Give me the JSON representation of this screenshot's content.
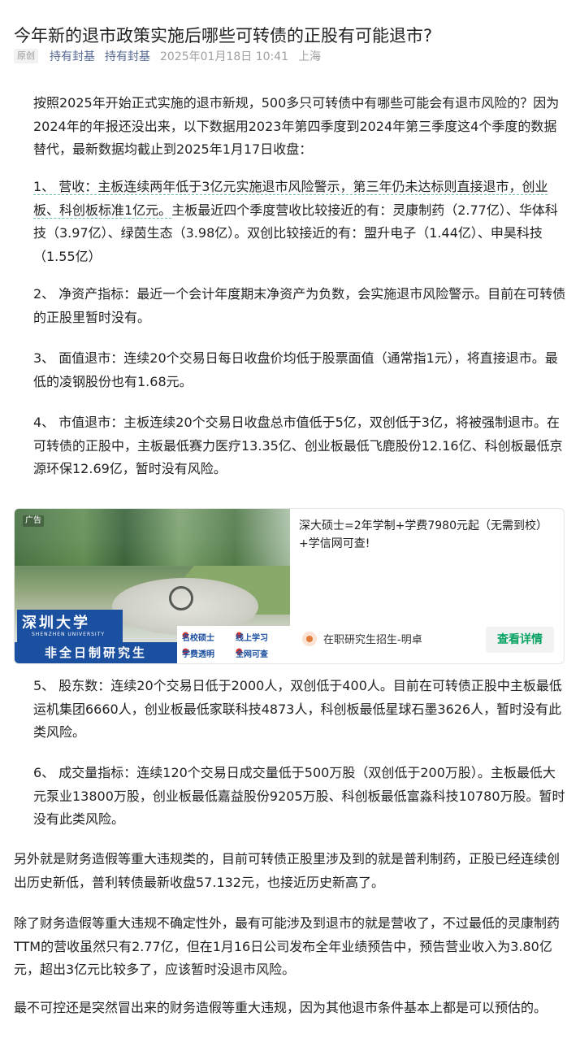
{
  "article": {
    "title": "今年新的退市政策实施后哪些可转债的正股有可能退市?",
    "badge": "原创",
    "author": "持有封基",
    "account": "持有封基",
    "datetime": "2025年01月18日 10:41",
    "location": "上海"
  },
  "paragraphs": {
    "intro": "按照2025年开始正式实施的退市新规，500多只可转债中有哪些可能会有退市风险的？因为2024年的年报还没出来，以下数据用2023年第四季度到2024年第三季度这4个季度的数据替代，最新数据均截止到2025年1月17日收盘：",
    "p1_lead": "1、 营收：主板连续两年低于3亿元实施退市风险警示，第三年仍未达标则直接退市，创业板、科创板标准1亿元。",
    "p1_rest": "主板最近四个季度营收比较接近的有：灵康制药（2.77亿）、华体科技（3.97亿）、绿茵生态（3.98亿）。双创比较接近的有：盟升电子（1.44亿）、申昊科技（1.55亿）",
    "p2": "2、 净资产指标：最近一个会计年度期末净资产为负数，会实施退市风险警示。目前在可转债的正股里暂时没有。",
    "p3": "3、 面值退市：连续20个交易日每日收盘价均低于股票面值（通常指1元），将直接退市。最低的凌钢股份也有1.68元。",
    "p4": "4、 市值退市：主板连续20个交易日收盘总市值低于5亿，双创低于3亿，将被强制退市。在可转债的正股中，主板最低赛力医疗13.35亿、创业板最低飞鹿股份12.16亿、科创板最低京源环保12.69亿，暂时没有风险。",
    "p5": "5、 股东数：连续20个交易日低于2000人，双创低于400人。目前在可转债正股中主板最低运机集团6660人，创业板最低家联科技4873人，科创板最低星球石墨3626人，暂时没有此类风险。",
    "p6": "6、 成交量指标：连续120个交易日成交量低于500万股（双创低于200万股）。主板最低大元泵业13800万股，创业板最低嘉益股份9205万股、科创板最低富淼科技10780万股。暂时没有此类风险。",
    "p7": "另外就是财务造假等重大违规类的，目前可转债正股里涉及到的就是普利制药，正股已经连续创出历史新低，普利转债最新收盘57.132元，也接近历史新高了。",
    "p8": "除了财务造假等重大违规不确定性外，最有可能涉及到退市的就是营收了，不过最低的灵康制药TTM的营收虽然只有2.77亿，但在1月16日公司发布全年业绩预告中，预告营业收入为3.80亿元，超出3亿元比较多了，应该暂时没退市风险。",
    "p9": "最不可控还是突然冒出来的财务造假等重大违规，因为其他退市条件基本上都是可以预估的。"
  },
  "ad": {
    "tag": "广告",
    "university_cn": "深圳大学",
    "university_en": "SHENZHEN UNIVERSITY",
    "banner": "非全日制研究生",
    "points": [
      "名校硕士",
      "线上学习",
      "学费透明",
      "全网可查"
    ],
    "headline": "深大硕士=2年学制+学费7980元起（无需到校）+学信网可查!",
    "source": "在职研究生招生-明卓",
    "cta": "查看详情"
  },
  "colors": {
    "link": "#576b95",
    "dashed_underline": "#6cc4a3",
    "cta_green": "#07a363",
    "ad_blue": "#1b4fa0"
  }
}
